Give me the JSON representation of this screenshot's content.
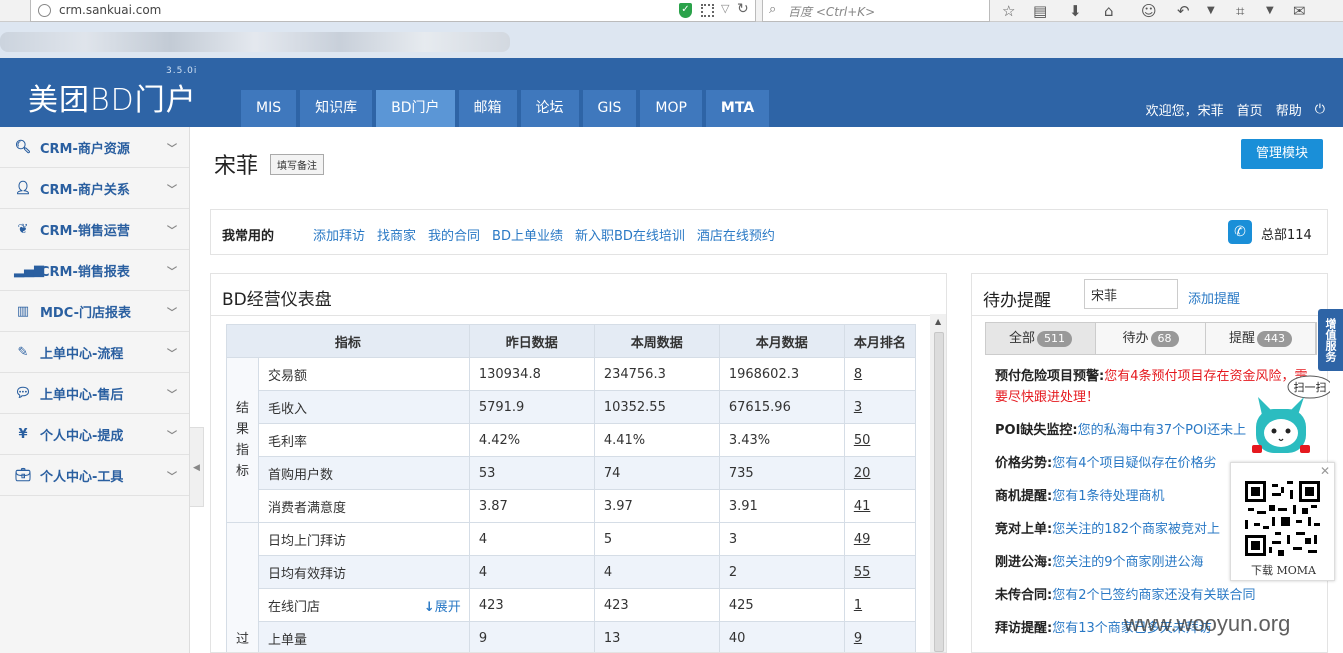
{
  "browser": {
    "url": "crm.sankuai.com",
    "search_placeholder": "百度 <Ctrl+K>"
  },
  "header": {
    "logo_main": "美团",
    "logo_sub": "BD门户",
    "version": "3.5.0i",
    "nav": [
      "MIS",
      "知识库",
      "BD门户",
      "邮箱",
      "论坛",
      "GIS",
      "MOP",
      "MTA"
    ],
    "active_nav": "BD门户",
    "welcome": "欢迎您，",
    "user": "宋菲",
    "home": "首页",
    "help": "帮助"
  },
  "sidebar": {
    "items": [
      {
        "label": "CRM-商户资源",
        "icon": "search-icon"
      },
      {
        "label": "CRM-商户关系",
        "icon": "user-icon"
      },
      {
        "label": "CRM-销售运营",
        "icon": "leaf-icon"
      },
      {
        "label": "CRM-销售报表",
        "icon": "signal-icon"
      },
      {
        "label": "MDC-门店报表",
        "icon": "bar-chart-icon"
      },
      {
        "label": "上单中心-流程",
        "icon": "edit-icon"
      },
      {
        "label": "上单中心-售后",
        "icon": "comment-icon"
      },
      {
        "label": "个人中心-提成",
        "icon": "yen-icon"
      },
      {
        "label": "个人中心-工具",
        "icon": "briefcase-icon"
      }
    ]
  },
  "page": {
    "name": "宋菲",
    "note_button": "填写备注",
    "manage_button": "管理模块"
  },
  "favorites": {
    "label": "我常用的",
    "links": [
      "添加拜访",
      "找商家",
      "我的合同",
      "BD上单业绩",
      "新入职BD在线培训",
      "酒店在线预约"
    ],
    "hq": "总部114"
  },
  "dashboard": {
    "title": "BD经营仪表盘",
    "headers": [
      "指标",
      "昨日数据",
      "本周数据",
      "本月数据",
      "本月排名"
    ],
    "groups": [
      {
        "name": "结果指标",
        "rows": [
          {
            "metric": "交易额",
            "yesterday": "130934.8",
            "week": "234756.3",
            "month": "1968602.3",
            "rank": "8"
          },
          {
            "metric": "毛收入",
            "yesterday": "5791.9",
            "week": "10352.55",
            "month": "67615.96",
            "rank": "3"
          },
          {
            "metric": "毛利率",
            "yesterday": "4.42%",
            "week": "4.41%",
            "month": "3.43%",
            "rank": "50"
          },
          {
            "metric": "首购用户数",
            "yesterday": "53",
            "week": "74",
            "month": "735",
            "rank": "20"
          },
          {
            "metric": "消费者满意度",
            "yesterday": "3.87",
            "week": "3.97",
            "month": "3.91",
            "rank": "41"
          }
        ]
      },
      {
        "name": "过",
        "rows": [
          {
            "metric": "日均上门拜访",
            "yesterday": "4",
            "week": "5",
            "month": "3",
            "rank": "49"
          },
          {
            "metric": "日均有效拜访",
            "yesterday": "4",
            "week": "4",
            "month": "2",
            "rank": "55"
          },
          {
            "metric": "在线门店",
            "expand": "展开",
            "yesterday": "423",
            "week": "423",
            "month": "425",
            "rank": "1"
          },
          {
            "metric": "上单量",
            "yesterday": "9",
            "week": "13",
            "month": "40",
            "rank": "9"
          }
        ]
      }
    ]
  },
  "todo": {
    "title": "待办提醒",
    "search_value": "宋菲",
    "add_link": "添加提醒",
    "tabs": [
      {
        "label": "全部",
        "count": "511"
      },
      {
        "label": "待办",
        "count": "68"
      },
      {
        "label": "提醒",
        "count": "443"
      }
    ],
    "items": [
      {
        "title": "预付危险项目预警:",
        "text": "您有4条预付项目存在资金风险，需要尽快跟进处理！",
        "style": "warn"
      },
      {
        "title": "POI缺失监控:",
        "text": "您的私海中有37个POI还未上",
        "style": "info"
      },
      {
        "title": "价格劣势:",
        "text": "您有4个项目疑似存在价格劣",
        "style": "info"
      },
      {
        "title": "商机提醒:",
        "text": "您有1条待处理商机",
        "style": "info"
      },
      {
        "title": "竞对上单:",
        "text": "您关注的182个商家被竞对上",
        "style": "info"
      },
      {
        "title": "刚进公海:",
        "text": "您关注的9个商家刚进公海",
        "style": "info"
      },
      {
        "title": "未传合同:",
        "text": "您有2个已签约商家还没有关联合同",
        "style": "info"
      },
      {
        "title": "拜访提醒:",
        "text": "您有13个商家已多天未拜访",
        "style": "info"
      }
    ]
  },
  "floating": {
    "side_tab": "增值服务",
    "mascot_text": "扫一扫",
    "qr_caption": "下载 MOMA"
  },
  "watermark": "www.wooyun.org",
  "colors": {
    "header": "#2e64a6",
    "active_tab": "#5b96d6",
    "link": "#2a79c5",
    "warn": "#e5191f",
    "button": "#1a8fd8"
  }
}
